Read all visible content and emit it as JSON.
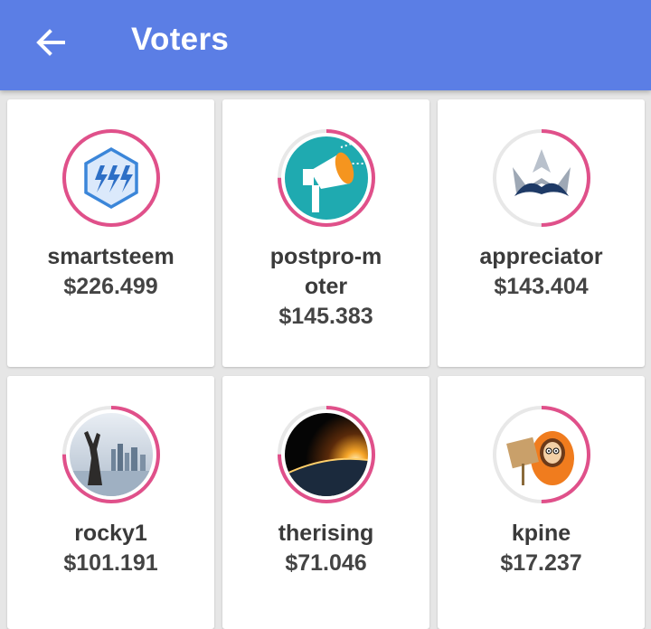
{
  "header": {
    "title": "Voters",
    "back_icon": "arrow-left-icon"
  },
  "colors": {
    "appbar": "#5b7ee5",
    "ring": "#e0508a",
    "ring_track": "#e8e8e8"
  },
  "voters": [
    {
      "name": "smartsteem",
      "value": "$226.499",
      "vote_fraction": 1.0,
      "avatar_icon": "smartsteem-lightning-hex-logo"
    },
    {
      "name": "postpro-moter",
      "value": "$145.383",
      "vote_fraction": 0.75,
      "avatar_icon": "megaphone-logo"
    },
    {
      "name": "appreciator",
      "value": "$143.404",
      "vote_fraction": 0.5,
      "avatar_icon": "crown-mountain-logo"
    },
    {
      "name": "rocky1",
      "value": "$101.191",
      "vote_fraction": 0.75,
      "avatar_icon": "rocky-city-photo"
    },
    {
      "name": "therising",
      "value": "$71.046",
      "vote_fraction": 0.75,
      "avatar_icon": "sunrise-planet-photo"
    },
    {
      "name": "kpine",
      "value": "$17.237",
      "vote_fraction": 0.5,
      "avatar_icon": "kenny-sign-cartoon"
    }
  ]
}
